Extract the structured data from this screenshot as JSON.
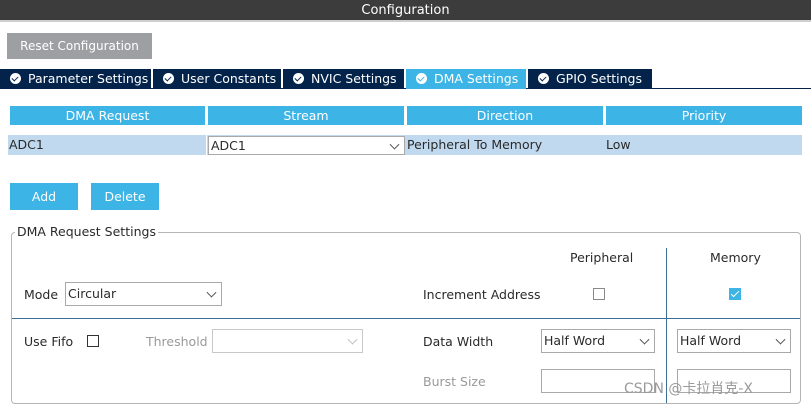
{
  "window": {
    "title": "Configuration"
  },
  "toolbar": {
    "reset_label": "Reset Configuration"
  },
  "tabs": [
    {
      "label": "Parameter Settings",
      "icon": "check-circle-icon",
      "active": false
    },
    {
      "label": "User Constants",
      "icon": "check-circle-icon",
      "active": false
    },
    {
      "label": "NVIC Settings",
      "icon": "check-circle-icon",
      "active": false
    },
    {
      "label": "DMA Settings",
      "icon": "check-circle-icon",
      "active": true
    },
    {
      "label": "GPIO Settings",
      "icon": "check-circle-icon",
      "active": false
    }
  ],
  "dma_table": {
    "columns": [
      "DMA Request",
      "Stream",
      "Direction",
      "Priority"
    ],
    "rows": [
      {
        "request": "ADC1",
        "stream": "ADC1",
        "direction": "Peripheral To Memory",
        "priority": "Low"
      }
    ]
  },
  "actions": {
    "add_label": "Add",
    "delete_label": "Delete"
  },
  "settings": {
    "group_title": "DMA Request Settings",
    "peripheral_header": "Peripheral",
    "memory_header": "Memory",
    "mode_label": "Mode",
    "mode_value": "Circular",
    "increment_label": "Increment Address",
    "increment_peripheral": false,
    "increment_memory": true,
    "fifo_label": "Use Fifo",
    "fifo_checked": false,
    "threshold_label": "Threshold",
    "threshold_value": "",
    "data_width_label": "Data Width",
    "peripheral_width": "Half Word",
    "memory_width": "Half Word",
    "burst_label": "Burst Size",
    "peripheral_burst": "",
    "memory_burst": ""
  },
  "watermark": "CSDN @卡拉肖克-X",
  "colors": {
    "tab_dark": "#03234b",
    "accent": "#3cb4e6",
    "row_highlight": "#c1d9ef",
    "title_bar": "#3c3c3c",
    "reset_button": "#9d9fa2"
  }
}
